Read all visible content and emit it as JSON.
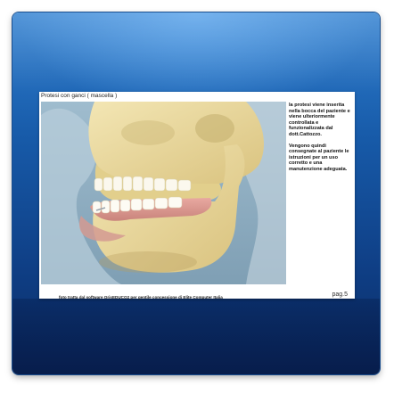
{
  "slide": {
    "title": "Protesi con ganci  ( mascella )",
    "paragraph1": "la protesi viene inserita nella bocca del paziente e viene ulteriormente controllata e funzionalizzata dal dott.Cattozzo.",
    "paragraph2": "Vengono quindi consegnate al paziente le istruzioni per un uso corretto e una manutenzione adeguata.",
    "caption": "foto tratta dal software OrisEDUCO2 per gentile concessione di Elite Computer Italia",
    "page": "pag.5"
  },
  "colors": {
    "frame_top": "#2f7fd0",
    "frame_bottom": "#0a2b63",
    "bone": "#e8d79a",
    "background_photo": "#8fb0c4"
  },
  "image": {
    "subject": "skull-with-partial-denture-illustration"
  }
}
